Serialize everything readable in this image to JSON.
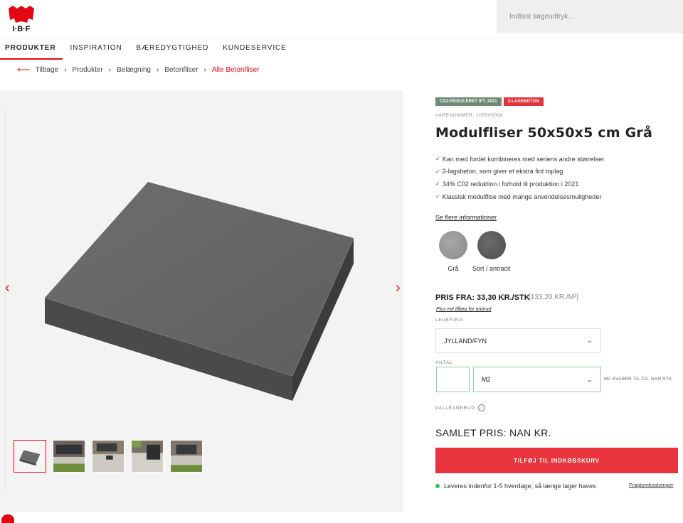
{
  "brand": {
    "name": "I-B-F",
    "accent_color": "#e30613"
  },
  "search": {
    "placeholder": "Indtast søgeudtryk..."
  },
  "nav": {
    "items": [
      "PRODUKTER",
      "INSPIRATION",
      "BÆREDYGTIGHED",
      "KUNDESERVICE"
    ],
    "active": "PRODUKTER"
  },
  "breadcrumb": {
    "back": "Tilbage",
    "items": [
      "Produkter",
      "Belægning",
      "Betonfliser"
    ],
    "current": "Alle Betonfliser"
  },
  "gallery": {
    "prev_icon": "chevron-left-icon",
    "next_icon": "chevron-right-icon",
    "thumbnail_count": 5,
    "active_thumbnail": 0
  },
  "product": {
    "badges": [
      {
        "label": "CO2-REDUCERET IFT. 2021",
        "color": "#6e8b74"
      },
      {
        "label": "2-LAGSBETON",
        "color": "#e2343d"
      }
    ],
    "sku": "VARENUMMER: 105505000",
    "title": "Modulfliser 50x50x5 cm Grå",
    "features": [
      "Kan med fordel kombineres med seriens andre størrelser",
      "2-lagsbeton, som giver et ekstra fint toplag",
      "34% C02 reduktion i forhold til produktion i 2021",
      "Klassisk modulflise med mange anvendelsesmuligheder"
    ],
    "more_info": "Se flere informationer",
    "colors": [
      {
        "label": "Grå",
        "swatch": "#9a9a9a"
      },
      {
        "label": "Sort / antracit",
        "swatch": "#5c5c5c"
      }
    ],
    "price": "PRIS FRA: 33,30 KR./STK",
    "price_m2": "[133,20 KR./M²]",
    "broken_note": "Plus evt tillæg for anbrud",
    "delivery_label": "LEVERING",
    "delivery_value": "JYLLAND/FYN",
    "quantity_label": "ANTAL",
    "quantity_value": "",
    "unit_value": "M2",
    "unit_note": "M2 SVARER TIL CA. NAN STK",
    "pallet_label": "PALLEANBRUD",
    "total": "SAMLET PRIS: NAN KR.",
    "cart_button": "TILFØJ TIL INDKØBSKURV",
    "stock_status": "Leveres indenfor 1-5 hverdage, så længe lager haves",
    "freight_link": "Fragtomkostninger"
  }
}
